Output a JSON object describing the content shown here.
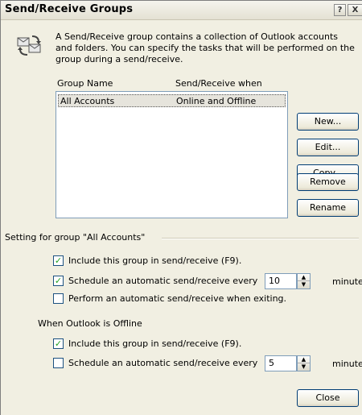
{
  "window": {
    "title": "Send/Receive Groups",
    "help_glyph": "?",
    "close_glyph": "X"
  },
  "intro": {
    "icon": "send-receive-icon",
    "text": "A Send/Receive group contains a collection of Outlook accounts and folders. You can specify the tasks that will be performed on the group during a send/receive."
  },
  "groups_list": {
    "columns": [
      "Group Name",
      "Send/Receive when"
    ],
    "rows": [
      {
        "name": "All Accounts",
        "when": "Online and Offline",
        "selected": true
      }
    ]
  },
  "buttons": {
    "new": "New...",
    "edit": "Edit...",
    "copy": "Copy...",
    "remove": "Remove",
    "rename": "Rename",
    "close": "Close"
  },
  "setting_group": {
    "label": "Setting for group \"All Accounts\"",
    "online": {
      "include": {
        "label": "Include this group in send/receive (F9).",
        "checked": true
      },
      "schedule": {
        "label": "Schedule an automatic send/receive every",
        "checked": true,
        "value": "10",
        "unit": "minutes."
      },
      "exit": {
        "label": "Perform an automatic send/receive when exiting.",
        "checked": false
      }
    },
    "offline_label": "When Outlook is Offline",
    "offline": {
      "include": {
        "label": "Include this group in send/receive (F9).",
        "checked": true
      },
      "schedule": {
        "label": "Schedule an automatic send/receive every",
        "checked": false,
        "value": "5",
        "unit": "minutes."
      }
    }
  },
  "colors": {
    "dialog_bg": "#f1efe2",
    "check_mark": "#21a121",
    "button_border": "#003c74"
  }
}
